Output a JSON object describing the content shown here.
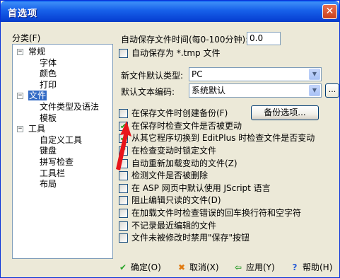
{
  "window": {
    "title": "首选项",
    "close_glyph": "✕"
  },
  "sidebar": {
    "label": "分类(F)",
    "tree": [
      {
        "label": "常规",
        "level": 0,
        "expander": "⊟"
      },
      {
        "label": "字体",
        "level": 1
      },
      {
        "label": "颜色",
        "level": 1
      },
      {
        "label": "打印",
        "level": 1
      },
      {
        "label": "文件",
        "level": 0,
        "expander": "⊟",
        "selected": true
      },
      {
        "label": "文件类型及语法",
        "level": 1
      },
      {
        "label": "模板",
        "level": 1
      },
      {
        "label": "工具",
        "level": 0,
        "expander": "⊟"
      },
      {
        "label": "自定义工具",
        "level": 1
      },
      {
        "label": "键盘",
        "level": 1
      },
      {
        "label": "拼写检查",
        "level": 1
      },
      {
        "label": "工具栏",
        "level": 1
      },
      {
        "label": "布局",
        "level": 1
      }
    ]
  },
  "autosave": {
    "label": "自动保存文件时间(每0-100分钟):",
    "value": "0.0"
  },
  "autosave_tmp": {
    "label": "自动保存为 *.tmp 文件",
    "checked": false
  },
  "newfile": {
    "label": "新文件默认类型:",
    "value": "PC"
  },
  "encoding": {
    "label": "默认文本编码:",
    "value": "系统默认",
    "more": "..."
  },
  "backup_button": "备份选项...",
  "options": [
    {
      "label": "在保存文件时创建备份(F)",
      "checked": false
    },
    {
      "label": "在保存时检查文件是否被更动",
      "checked": true
    },
    {
      "label": "从其它程序切换到 EditPlus 时检查文件是否变动",
      "checked": true
    },
    {
      "label": "在检查变动时锁定文件",
      "checked": true
    },
    {
      "label": "自动重新加载变动的文件(Z)",
      "checked": false
    },
    {
      "label": "检测文件是否被删除",
      "checked": false
    },
    {
      "label": "在 ASP 网页中默认使用 JScript 语言",
      "checked": false
    },
    {
      "label": "阻止编辑只读的文件(D)",
      "checked": false
    },
    {
      "label": "在加载文件时检查错误的回车换行符和空字符",
      "checked": false
    },
    {
      "label": "不记录最近编辑的文件",
      "checked": false
    },
    {
      "label": "文件未被修改时禁用\"保存\"按钮",
      "checked": false
    }
  ],
  "footer": {
    "ok": "确定(O)",
    "cancel": "取消(X)",
    "apply": "应用(Y)",
    "help": "帮助(H)"
  },
  "colors": {
    "accent": "#0a5ff2",
    "selection": "#316ac5",
    "arrow": "#e8141a"
  }
}
